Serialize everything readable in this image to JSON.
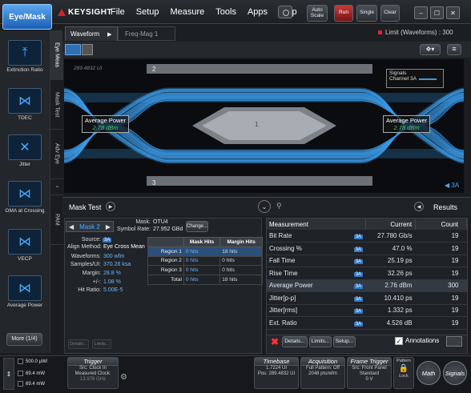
{
  "app": {
    "mode_button": "Eye/Mask",
    "logo_text": "KEYSIGHT",
    "menu": [
      "File",
      "Setup",
      "Measure",
      "Tools",
      "Apps",
      "Help"
    ],
    "toolbar": {
      "auto_scale": "Auto Scale",
      "run": "Run",
      "single": "Single",
      "clear": "Clear"
    },
    "window_buttons": [
      "–",
      "☐",
      "✕"
    ]
  },
  "left_panel": {
    "items": [
      {
        "label": "Extinction Ratio",
        "icon": "extinction-ratio-icon"
      },
      {
        "label": "TDEC",
        "icon": "tdec-icon"
      },
      {
        "label": "Jitter",
        "icon": "jitter-icon"
      },
      {
        "label": "OMA at Crossing",
        "icon": "oma-crossing-icon"
      },
      {
        "label": "VECP",
        "icon": "vecp-icon"
      },
      {
        "label": "Average Power",
        "icon": "average-power-icon"
      }
    ],
    "more_button": "More (1/4)"
  },
  "vertical_tabs": [
    "Eye Meas",
    "Mask Test",
    "Adv Eye",
    "PAM"
  ],
  "waveform": {
    "tabs": [
      "Waveform",
      "Freq-Mag 1"
    ],
    "limit_text": "Limit (Waveforms) : 300",
    "timestamp": "289.4832 UI",
    "region_labels": {
      "top": "2",
      "center": "1",
      "bottom": "3"
    },
    "left_marker": {
      "label": "Average Power",
      "value": "2.78 dBm"
    },
    "right_marker": {
      "label": "Average Power",
      "value": "2.78 dBm"
    },
    "legend": {
      "title": "Signals",
      "channel": "Channel 3A"
    },
    "channel_marker": "◀ 3A",
    "colors": {
      "eye": "#3b9be8",
      "mask": "#7d8289",
      "mask_inner": "#a8adb3"
    }
  },
  "mask_test": {
    "title": "Mask Test",
    "mask_nav": "Mask 2",
    "mask_label": "Mask:",
    "mask_value": "OTU4",
    "symbol_rate_label": "Symbol Rate:",
    "symbol_rate_value": "27.952 GBd",
    "change_button": "Change...",
    "source_label": "Source:",
    "source_value": "3A",
    "align_label": "Align Method:",
    "align_value": "Eye Cross Mean",
    "stats": [
      {
        "label": "Waveforms:",
        "value": "300 wfm"
      },
      {
        "label": "Samples/UI:",
        "value": "370.28 ksa"
      },
      {
        "label": "Margin:",
        "value": "28.8 %"
      },
      {
        "label": "+/-:",
        "value": "1.08 %"
      },
      {
        "label": "Hit Ratio:",
        "value": "5.00E-5"
      }
    ],
    "regions": {
      "headers": [
        "",
        "Mask Hits",
        "Margin Hits"
      ],
      "rows": [
        {
          "name": "Region 1",
          "mask": "0 hits",
          "margin": "18 hits"
        },
        {
          "name": "Region 2",
          "mask": "0 hits",
          "margin": "0 hits"
        },
        {
          "name": "Region 3",
          "mask": "0 hits",
          "margin": "0 hits"
        },
        {
          "name": "Total",
          "mask": "0 hits",
          "margin": "18 hits"
        }
      ]
    },
    "details_button": "Details...",
    "limits_button": "Limits..."
  },
  "results": {
    "title": "Results",
    "headers": [
      "Measurement",
      "Current",
      "Count"
    ],
    "rows": [
      {
        "name": "Bit Rate",
        "ch": "3A",
        "current": "27.780 Gb/s",
        "count": "19"
      },
      {
        "name": "Crossing %",
        "ch": "3A",
        "current": "47.0 %",
        "count": "19"
      },
      {
        "name": "Fall Time",
        "ch": "3A",
        "current": "25.19 ps",
        "count": "19"
      },
      {
        "name": "Rise Time",
        "ch": "3A",
        "current": "32.26 ps",
        "count": "19"
      },
      {
        "name": "Average Power",
        "ch": "3A",
        "current": "2.76 dBm",
        "count": "300"
      },
      {
        "name": "Jitter[p-p]",
        "ch": "3A",
        "current": "10.410 ps",
        "count": "19"
      },
      {
        "name": "Jitter[rms]",
        "ch": "3A",
        "current": "1.332 ps",
        "count": "19"
      },
      {
        "name": "Ext. Ratio",
        "ch": "3A",
        "current": "4.526 dB",
        "count": "19"
      }
    ],
    "details_button": "Details...",
    "limits_button": "Limits...",
    "setup_button": "Setup...",
    "annotations_label": "Annotations"
  },
  "statusbar": {
    "channel_rows": [
      "500.0 µW/",
      "69.4 mW",
      "69.4 mW"
    ],
    "trigger": {
      "title": "Trigger",
      "lines": [
        "Src: Clock In",
        "Measured Clock:",
        "13.976 GHz"
      ]
    },
    "timebase": {
      "title": "Timebase",
      "lines": [
        "1.7224 UI",
        "Pos: 289.4832 UI"
      ]
    },
    "acquisition": {
      "title": "Acquisition",
      "lines": [
        "Full Pattern: Off",
        "2048 pts/wfm"
      ]
    },
    "frame_trigger": {
      "title": "Frame Trigger",
      "lines": [
        "Src: Front Panel",
        "Standard",
        "0 V"
      ]
    },
    "pattern_label": "Pattern",
    "lock_label": "Lock",
    "math_button": "Math",
    "signals_button": "Signals"
  }
}
